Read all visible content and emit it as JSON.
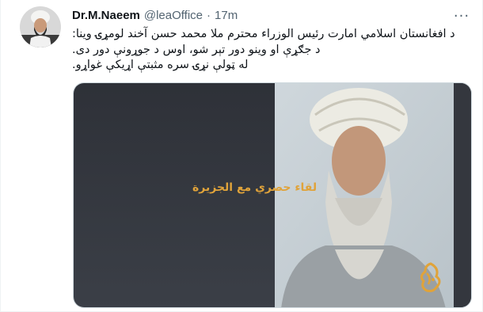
{
  "tweet": {
    "author_name": "Dr.M.Naeem",
    "handle": "@leaOffice",
    "separator": "·",
    "time": "17m",
    "more_icon": "more-horizontal-icon",
    "text_lines": [
      "د افغانستان اسلامي امارت رئيس الوزراء محترم ملا محمد حسن آخند لومړۍ وينا:",
      "د جګړې او وينو دور تېر شو، اوس د جوړونې دور دی.",
      "له ټولې نړۍ سره مثبتې اړيکې غواړو."
    ]
  },
  "media": {
    "caption": "لقاء حصري مع الجزيرة",
    "logo_icon": "al-jazeera-logo-icon",
    "accent_color": "#e0a33a"
  }
}
